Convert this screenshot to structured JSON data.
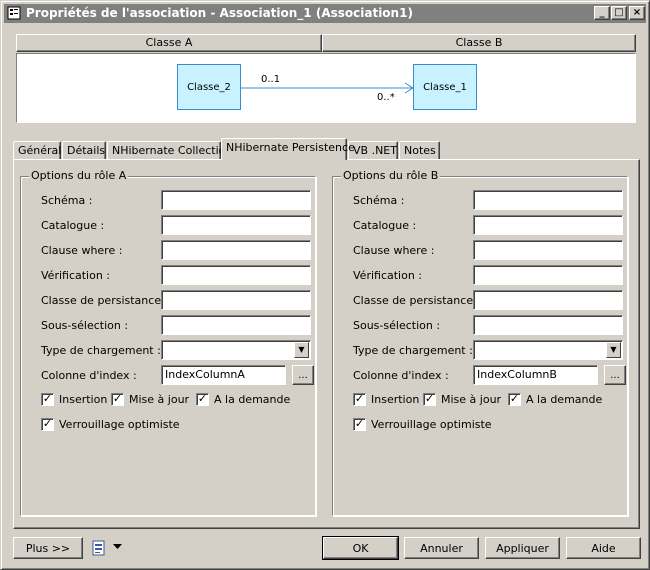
{
  "window": {
    "title": "Propriétés de l'association - Association_1 (Association1)",
    "minimize": "_",
    "maximize": "□",
    "close": "×"
  },
  "classes_header": {
    "left": "Classe A",
    "right": "Classe B"
  },
  "diagram": {
    "left_class": "Classe_2",
    "right_class": "Classe_1",
    "mult_left": "0..1",
    "mult_right": "0..*"
  },
  "tabs": [
    {
      "label": "Général",
      "active": false
    },
    {
      "label": "Détails",
      "active": false
    },
    {
      "label": "NHibernate Collection",
      "active": false
    },
    {
      "label": "NHibernate Persistence",
      "active": true
    },
    {
      "label": "VB .NET",
      "active": false
    },
    {
      "label": "Notes",
      "active": false
    }
  ],
  "role_a": {
    "title": "Options du rôle A",
    "labels": {
      "schema": "Schéma :",
      "catalogue": "Catalogue :",
      "clause_where": "Clause where :",
      "verification": "Vérification :",
      "classe_persistance": "Classe de persistance :",
      "sous_selection": "Sous-sélection :",
      "type_chargement": "Type de chargement :",
      "colonne_index": "Colonne d'index :"
    },
    "values": {
      "schema": "",
      "catalogue": "",
      "clause_where": "",
      "verification": "",
      "classe_persistance": "",
      "sous_selection": "",
      "type_chargement": "",
      "colonne_index": "IndexColumnA"
    },
    "browse_label": "...",
    "checkboxes": {
      "insertion": {
        "label": "Insertion",
        "checked": true
      },
      "mise_a_jour": {
        "label": "Mise à jour",
        "checked": true
      },
      "a_la_demande": {
        "label": "A la demande",
        "checked": true
      },
      "verrouillage": {
        "label": "Verrouillage optimiste",
        "checked": true
      }
    }
  },
  "role_b": {
    "title": "Options du rôle B",
    "labels": {
      "schema": "Schéma :",
      "catalogue": "Catalogue :",
      "clause_where": "Clause where :",
      "verification": "Vérification :",
      "classe_persistance": "Classe de persistance :",
      "sous_selection": "Sous-sélection :",
      "type_chargement": "Type de chargement :",
      "colonne_index": "Colonne d'index :"
    },
    "values": {
      "schema": "",
      "catalogue": "",
      "clause_where": "",
      "verification": "",
      "classe_persistance": "",
      "sous_selection": "",
      "type_chargement": "",
      "colonne_index": "IndexColumnB"
    },
    "browse_label": "...",
    "checkboxes": {
      "insertion": {
        "label": "Insertion",
        "checked": true
      },
      "mise_a_jour": {
        "label": "Mise à jour",
        "checked": true
      },
      "a_la_demande": {
        "label": "A la demande",
        "checked": true
      },
      "verrouillage": {
        "label": "Verrouillage optimiste",
        "checked": true
      }
    }
  },
  "footer": {
    "plus": "Plus >>",
    "ok": "OK",
    "annuler": "Annuler",
    "appliquer": "Appliquer",
    "aide": "Aide"
  },
  "checkmark": "✓",
  "dropdown_arrow": "▼"
}
